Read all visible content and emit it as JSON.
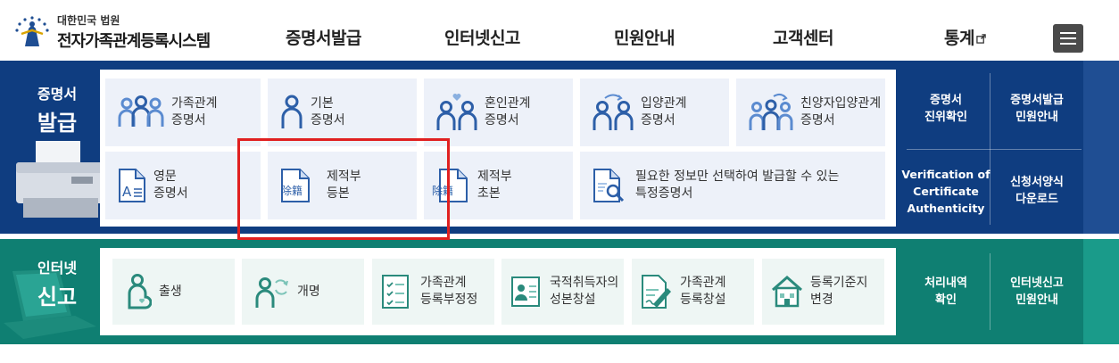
{
  "header": {
    "logo_sub": "대한민국 법원",
    "logo_main": "전자가족관계등록시스템",
    "nav": [
      {
        "label": "증명서발급"
      },
      {
        "label": "인터넷신고"
      },
      {
        "label": "민원안내"
      },
      {
        "label": "고객센터"
      },
      {
        "label": "통계"
      }
    ]
  },
  "certificate": {
    "title_line1": "증명서",
    "title_line2": "발급",
    "tiles": [
      {
        "l1": "가족관계",
        "l2": "증명서",
        "icon": "family-icon"
      },
      {
        "l1": "기본",
        "l2": "증명서",
        "icon": "person-icon"
      },
      {
        "l1": "혼인관계",
        "l2": "증명서",
        "icon": "marriage-icon"
      },
      {
        "l1": "입양관계",
        "l2": "증명서",
        "icon": "adoption-icon"
      },
      {
        "l1": "친양자입양관계",
        "l2": "증명서",
        "icon": "full-adoption-icon"
      },
      {
        "l1": "영문",
        "l2": "증명서",
        "icon": "english-doc-icon"
      },
      {
        "l1": "제적부",
        "l2": "등본",
        "icon": "removed-register-doc-icon"
      },
      {
        "l1": "제적부",
        "l2": "초본",
        "icon": "removed-register-extract-icon"
      },
      {
        "l1": "필요한 정보만 선택하여 발급할 수 있는",
        "l2": "특정증명서",
        "icon": "doc-search-icon"
      }
    ],
    "doc_icon_text": "除籍",
    "english_icon_text": "A",
    "side": [
      {
        "l1": "증명서",
        "l2": "진위확인"
      },
      {
        "l1": "증명서발급",
        "l2": "민원안내"
      },
      {
        "l1": "Verification of",
        "l2": "Certificate",
        "l3": "Authenticity"
      },
      {
        "l1": "신청서양식",
        "l2": "다운로드"
      }
    ]
  },
  "report": {
    "title_line1": "인터넷",
    "title_line2": "신고",
    "tiles": [
      {
        "l1": "출생",
        "l2": "",
        "icon": "birth-icon"
      },
      {
        "l1": "개명",
        "l2": "",
        "icon": "rename-icon"
      },
      {
        "l1": "가족관계",
        "l2": "등록부정정",
        "icon": "checklist-icon"
      },
      {
        "l1": "국적취득자의",
        "l2": "성본창설",
        "icon": "id-card-icon"
      },
      {
        "l1": "가족관계",
        "l2": "등록창설",
        "icon": "doc-edit-icon"
      },
      {
        "l1": "등록기준지",
        "l2": "변경",
        "icon": "house-icon"
      }
    ],
    "side": [
      {
        "l1": "처리내역",
        "l2": "확인"
      },
      {
        "l1": "인터넷신고",
        "l2": "민원안내"
      }
    ]
  },
  "colors": {
    "cert_band": "#0f3d80",
    "report_band": "#0f7f72",
    "icon_blue": "#2d5fa8",
    "icon_green": "#2a8a7c",
    "highlight": "#e02020"
  }
}
